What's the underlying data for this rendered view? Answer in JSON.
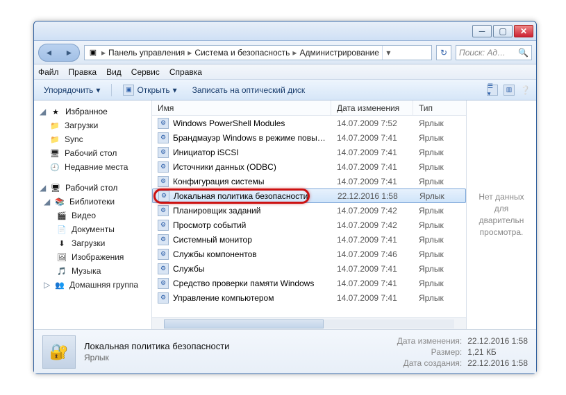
{
  "titlebar": {
    "min": "─",
    "max": "▢",
    "close": "✕"
  },
  "breadcrumb": {
    "icon": "▣",
    "segs": [
      "Панель управления",
      "Система и безопасность",
      "Администрирование"
    ]
  },
  "search": {
    "placeholder": "Поиск: Ад…"
  },
  "menu": [
    "Файл",
    "Правка",
    "Вид",
    "Сервис",
    "Справка"
  ],
  "toolbar": {
    "organize": "Упорядочить",
    "open": "Открыть",
    "burn": "Записать на оптический диск"
  },
  "nav": {
    "favorites": {
      "label": "Избранное",
      "items": [
        "Загрузки",
        "Sync",
        "Рабочий стол",
        "Недавние места"
      ]
    },
    "desktop": {
      "label": "Рабочий стол",
      "lib": "Библиотеки",
      "items": [
        "Видео",
        "Документы",
        "Загрузки",
        "Изображения",
        "Музыка"
      ],
      "homegroup": "Домашняя группа"
    }
  },
  "columns": {
    "name": "Имя",
    "date": "Дата изменения",
    "type": "Тип"
  },
  "rows": [
    {
      "name": "Windows PowerShell Modules",
      "date": "14.07.2009 7:52",
      "type": "Ярлык"
    },
    {
      "name": "Брандмауэр Windows в режиме повы…",
      "date": "14.07.2009 7:41",
      "type": "Ярлык"
    },
    {
      "name": "Инициатор iSCSI",
      "date": "14.07.2009 7:41",
      "type": "Ярлык"
    },
    {
      "name": "Источники данных (ODBC)",
      "date": "14.07.2009 7:41",
      "type": "Ярлык"
    },
    {
      "name": "Конфигурация системы",
      "date": "14.07.2009 7:41",
      "type": "Ярлык"
    },
    {
      "name": "Локальная политика безопасности",
      "date": "22.12.2016 1:58",
      "type": "Ярлык",
      "sel": true
    },
    {
      "name": "Планировщик заданий",
      "date": "14.07.2009 7:42",
      "type": "Ярлык"
    },
    {
      "name": "Просмотр событий",
      "date": "14.07.2009 7:42",
      "type": "Ярлык"
    },
    {
      "name": "Системный монитор",
      "date": "14.07.2009 7:41",
      "type": "Ярлык"
    },
    {
      "name": "Службы компонентов",
      "date": "14.07.2009 7:46",
      "type": "Ярлык"
    },
    {
      "name": "Службы",
      "date": "14.07.2009 7:41",
      "type": "Ярлык"
    },
    {
      "name": "Средство проверки памяти Windows",
      "date": "14.07.2009 7:41",
      "type": "Ярлык"
    },
    {
      "name": "Управление компьютером",
      "date": "14.07.2009 7:41",
      "type": "Ярлык"
    }
  ],
  "preview_empty": "Нет данных для дварительн просмотра.",
  "details": {
    "title": "Локальная политика безопасности",
    "subtitle": "Ярлык",
    "props": {
      "modified_k": "Дата изменения:",
      "modified_v": "22.12.2016 1:58",
      "size_k": "Размер:",
      "size_v": "1,21 КБ",
      "created_k": "Дата создания:",
      "created_v": "22.12.2016 1:58"
    }
  }
}
